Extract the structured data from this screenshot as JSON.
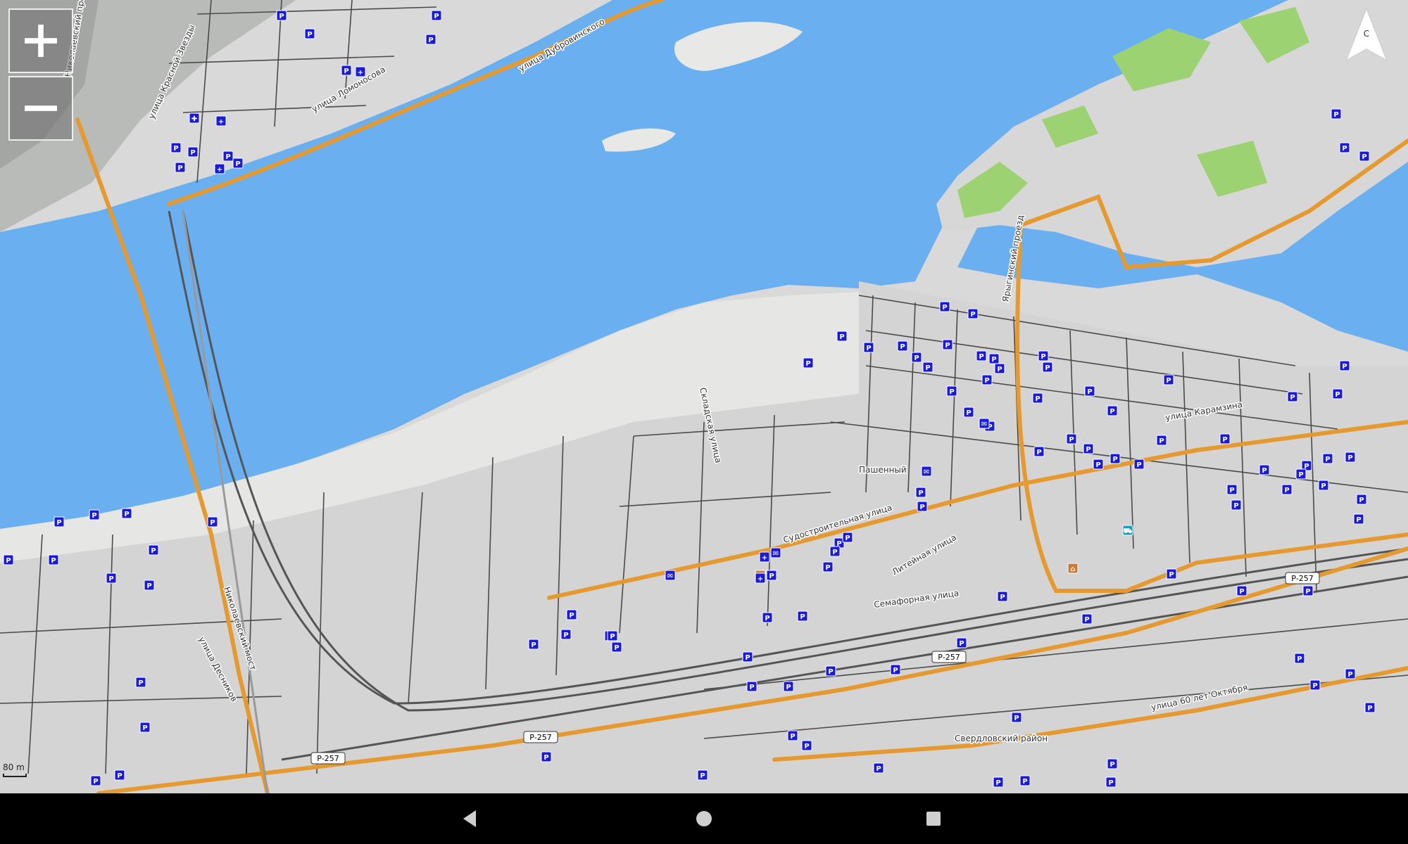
{
  "map": {
    "street_labels": [
      "улица Дубровинского",
      "улица Ломоносова",
      "улица Красной Звезды",
      "Николаевский проспект",
      "Ярыгинский проезд",
      "Складская улица",
      "Судостроительная улица",
      "Литейная улица",
      "Семафорная улица",
      "улица Карамзина",
      "улица 60 лет Октября",
      "Николаевский мост",
      "улица Десников"
    ],
    "place_labels": [
      "Пашенный",
      "Свердловский район"
    ],
    "road_shields": [
      "Р-257",
      "Р-257",
      "Р-257",
      "Р-257"
    ],
    "poi_icon": "parking-icon",
    "poi_text": "P",
    "poi_symbols": [
      "P",
      "+",
      "✚",
      "✉",
      "⌂",
      "⛟"
    ]
  },
  "controls": {
    "zoom_in_icon": "plus-icon",
    "zoom_out_icon": "minus-icon",
    "compass_letter": "С"
  },
  "scale": {
    "label": "80 m"
  },
  "navbar": {
    "back_icon": "back-triangle-icon",
    "home_icon": "home-circle-icon",
    "recent_icon": "recent-square-icon"
  },
  "colors": {
    "water": "#6aaff0",
    "land": "#d8d9d8",
    "sand": "#e8e8e6",
    "park": "#9cd272",
    "road_major": "#e6992e",
    "road_minor": "#4a4a4a",
    "poi_parking": "#1a1adc",
    "nav_bar": "#000000"
  }
}
